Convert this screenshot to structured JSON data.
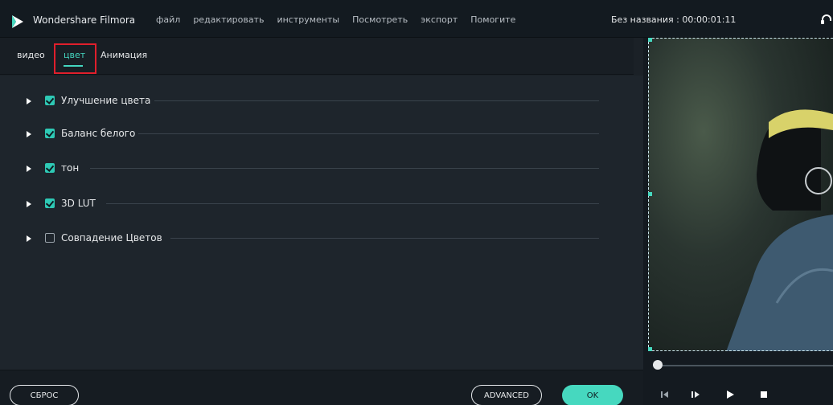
{
  "app": {
    "name": "Wondershare Filmora",
    "project_title": "Без названия : 00:00:01:11"
  },
  "menu": [
    "файл",
    "редактировать",
    "инструменты",
    "Посмотреть",
    "экспорт",
    "Помогите"
  ],
  "tabs": [
    {
      "label": "видео",
      "active": false
    },
    {
      "label": "цвет",
      "active": true
    },
    {
      "label": "Анимация",
      "active": false
    }
  ],
  "sections": [
    {
      "label": "Улучшение цвета",
      "checked": true
    },
    {
      "label": "Баланс белого",
      "checked": true
    },
    {
      "label": "тон",
      "checked": true
    },
    {
      "label": "3D LUT",
      "checked": true
    },
    {
      "label": "Совпадение Цветов",
      "checked": false
    }
  ],
  "buttons": {
    "reset": "СБРОС",
    "advanced": "ADVANCED",
    "ok": "OK"
  },
  "colors": {
    "accent": "#46d8bf",
    "highlight": "#e01f2c",
    "background": "#1e252c"
  },
  "icons": {
    "logo": "filmora-logo-icon",
    "support": "headset-icon",
    "prev_frame": "previous-frame-icon",
    "play_slow": "step-forward-icon",
    "play": "play-icon",
    "stop": "stop-icon"
  }
}
